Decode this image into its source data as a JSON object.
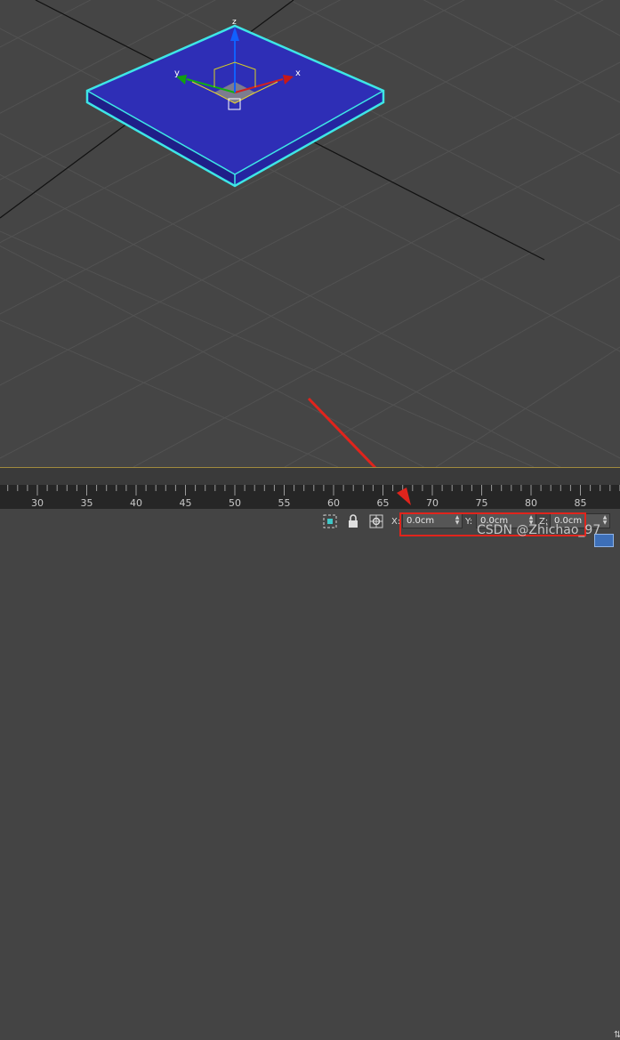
{
  "viewport": {
    "axis_x_label": "x",
    "axis_y_label": "y",
    "axis_z_label": "z",
    "object_color": "#2b2bb8",
    "selection_color": "#3ee6e6"
  },
  "timeline": {
    "ticks": [
      "30",
      "35",
      "40",
      "45",
      "50",
      "55",
      "60",
      "65",
      "70",
      "75",
      "80",
      "85"
    ]
  },
  "status": {
    "x_label": "X:",
    "x_value": "0.0cm",
    "y_label": "Y:",
    "y_value": "0.0cm",
    "z_label": "Z:",
    "z_value": "0.0cm",
    "spin_up": "▲",
    "spin_down": "▼",
    "edge_text": "⇅"
  },
  "annotation": {
    "watermark": "CSDN @Zhichao_97",
    "arrow_color": "#e0241c"
  }
}
